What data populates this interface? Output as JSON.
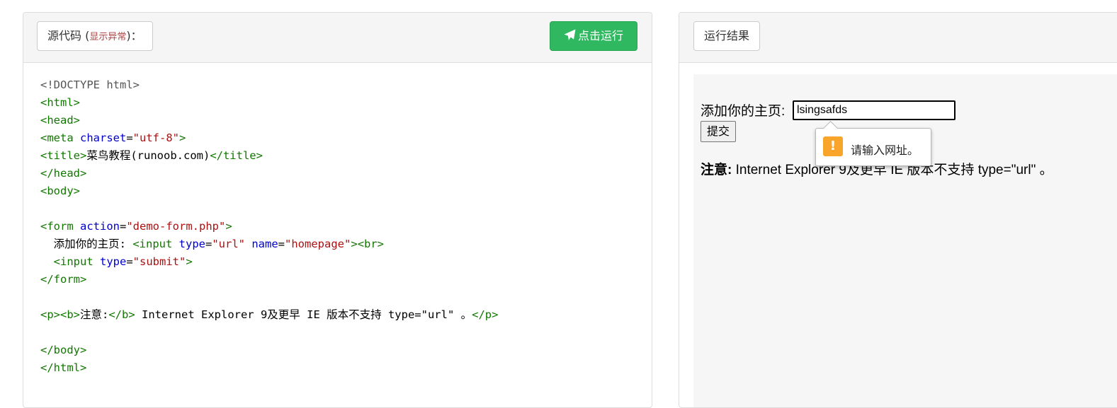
{
  "source_panel": {
    "label": "源代码",
    "error_toggle": "显示异常",
    "colon": "：",
    "run_button": "点击运行",
    "code_lines": [
      [
        {
          "t": "<!DOCTYPE html>",
          "c": "doctype"
        }
      ],
      [
        {
          "t": "<html>",
          "c": "tg"
        }
      ],
      [
        {
          "t": "<head>",
          "c": "tg"
        }
      ],
      [
        {
          "t": "<meta ",
          "c": "tg"
        },
        {
          "t": "charset",
          "c": "at"
        },
        {
          "t": "=",
          "c": ""
        },
        {
          "t": "\"utf-8\"",
          "c": "st"
        },
        {
          "t": ">",
          "c": "tg"
        }
      ],
      [
        {
          "t": "<title>",
          "c": "tg"
        },
        {
          "t": "菜鸟教程(runoob.com)",
          "c": ""
        },
        {
          "t": "</title>",
          "c": "tg"
        }
      ],
      [
        {
          "t": "</head>",
          "c": "tg"
        }
      ],
      [
        {
          "t": "<body>",
          "c": "tg"
        }
      ],
      [],
      [
        {
          "t": "<form ",
          "c": "tg"
        },
        {
          "t": "action",
          "c": "at"
        },
        {
          "t": "=",
          "c": ""
        },
        {
          "t": "\"demo-form.php\"",
          "c": "st"
        },
        {
          "t": ">",
          "c": "tg"
        }
      ],
      [
        {
          "t": "  添加你的主页: ",
          "c": ""
        },
        {
          "t": "<input ",
          "c": "tg"
        },
        {
          "t": "type",
          "c": "at"
        },
        {
          "t": "=",
          "c": ""
        },
        {
          "t": "\"url\"",
          "c": "st"
        },
        {
          "t": " ",
          "c": ""
        },
        {
          "t": "name",
          "c": "at"
        },
        {
          "t": "=",
          "c": ""
        },
        {
          "t": "\"homepage\"",
          "c": "st"
        },
        {
          "t": ">",
          "c": "tg"
        },
        {
          "t": "<br>",
          "c": "tg"
        }
      ],
      [
        {
          "t": "  ",
          "c": ""
        },
        {
          "t": "<input ",
          "c": "tg"
        },
        {
          "t": "type",
          "c": "at"
        },
        {
          "t": "=",
          "c": ""
        },
        {
          "t": "\"submit\"",
          "c": "st"
        },
        {
          "t": ">",
          "c": "tg"
        }
      ],
      [
        {
          "t": "</form>",
          "c": "tg"
        }
      ],
      [],
      [
        {
          "t": "<p>",
          "c": "tg"
        },
        {
          "t": "<b>",
          "c": "tg"
        },
        {
          "t": "注意:",
          "c": ""
        },
        {
          "t": "</b>",
          "c": "tg"
        },
        {
          "t": " Internet Explorer 9及更早 IE 版本不支持 type=\"url\" 。",
          "c": ""
        },
        {
          "t": "</p>",
          "c": "tg"
        }
      ],
      [],
      [
        {
          "t": "</body>",
          "c": "tg"
        }
      ],
      [
        {
          "t": "</html>",
          "c": "tg"
        }
      ]
    ]
  },
  "result_panel": {
    "label": "运行结果",
    "field_label": "添加你的主页:",
    "input_value": "lsingsafds",
    "submit_label": "提交",
    "note_bold": "注意:",
    "note_text": " Internet Explorer 9及更早 IE 版本不支持 type=\"url\" 。",
    "tooltip_icon": "!",
    "tooltip_text": "请输入网址。"
  },
  "colors": {
    "run_button": "#2fb860",
    "tag": "#117700",
    "attribute": "#0000cc",
    "string": "#aa1111",
    "warning": "#f9a52b"
  }
}
